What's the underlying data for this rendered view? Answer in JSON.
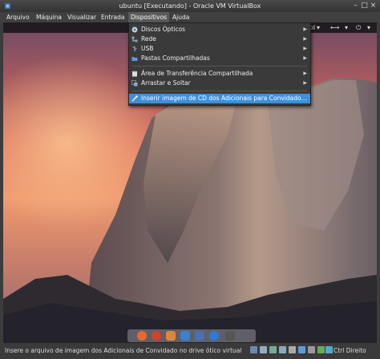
{
  "window": {
    "title": "ubuntu [Executando] - Oracle VM VirtualBox"
  },
  "menubar": {
    "items": [
      {
        "label": "Arquivo"
      },
      {
        "label": "Máquina"
      },
      {
        "label": "Visualizar"
      },
      {
        "label": "Entrada"
      },
      {
        "label": "Dispositivos"
      },
      {
        "label": "Ajuda"
      }
    ],
    "active": "Dispositivos"
  },
  "devices_menu": {
    "items": [
      {
        "label": "Discos Ópticos",
        "icon": "optical-disc-icon",
        "submenu": true
      },
      {
        "label": "Rede",
        "icon": "network-icon",
        "submenu": true
      },
      {
        "label": "USB",
        "icon": "usb-icon",
        "submenu": true
      },
      {
        "label": "Pastas Compartilhadas",
        "icon": "shared-folder-icon",
        "submenu": true
      },
      {
        "label": "Área de Transferência Compartilhada",
        "icon": "clipboard-icon",
        "submenu": true
      },
      {
        "label": "Arrastar e Soltar",
        "icon": "drag-drop-icon",
        "submenu": true
      },
      {
        "label": "Inserir imagem de CD dos Adicionais para Convidado...",
        "icon": "insert-cd-icon",
        "submenu": false,
        "highlighted": true
      }
    ]
  },
  "guest_topbar": {
    "partial_label": "ol",
    "icons": [
      "dropdown-icon",
      "keyboard-icon",
      "network-status-icon",
      "power-icon",
      "chevron-down-icon"
    ]
  },
  "statusbar": {
    "text": "Insere o arquivo de imagem dos Adicionais de Convidado no drive ótico virtual",
    "host_key": "Ctrl Direito"
  },
  "colors": {
    "highlight": "#3d8fd8",
    "menu_bg": "#3a3a3a"
  }
}
